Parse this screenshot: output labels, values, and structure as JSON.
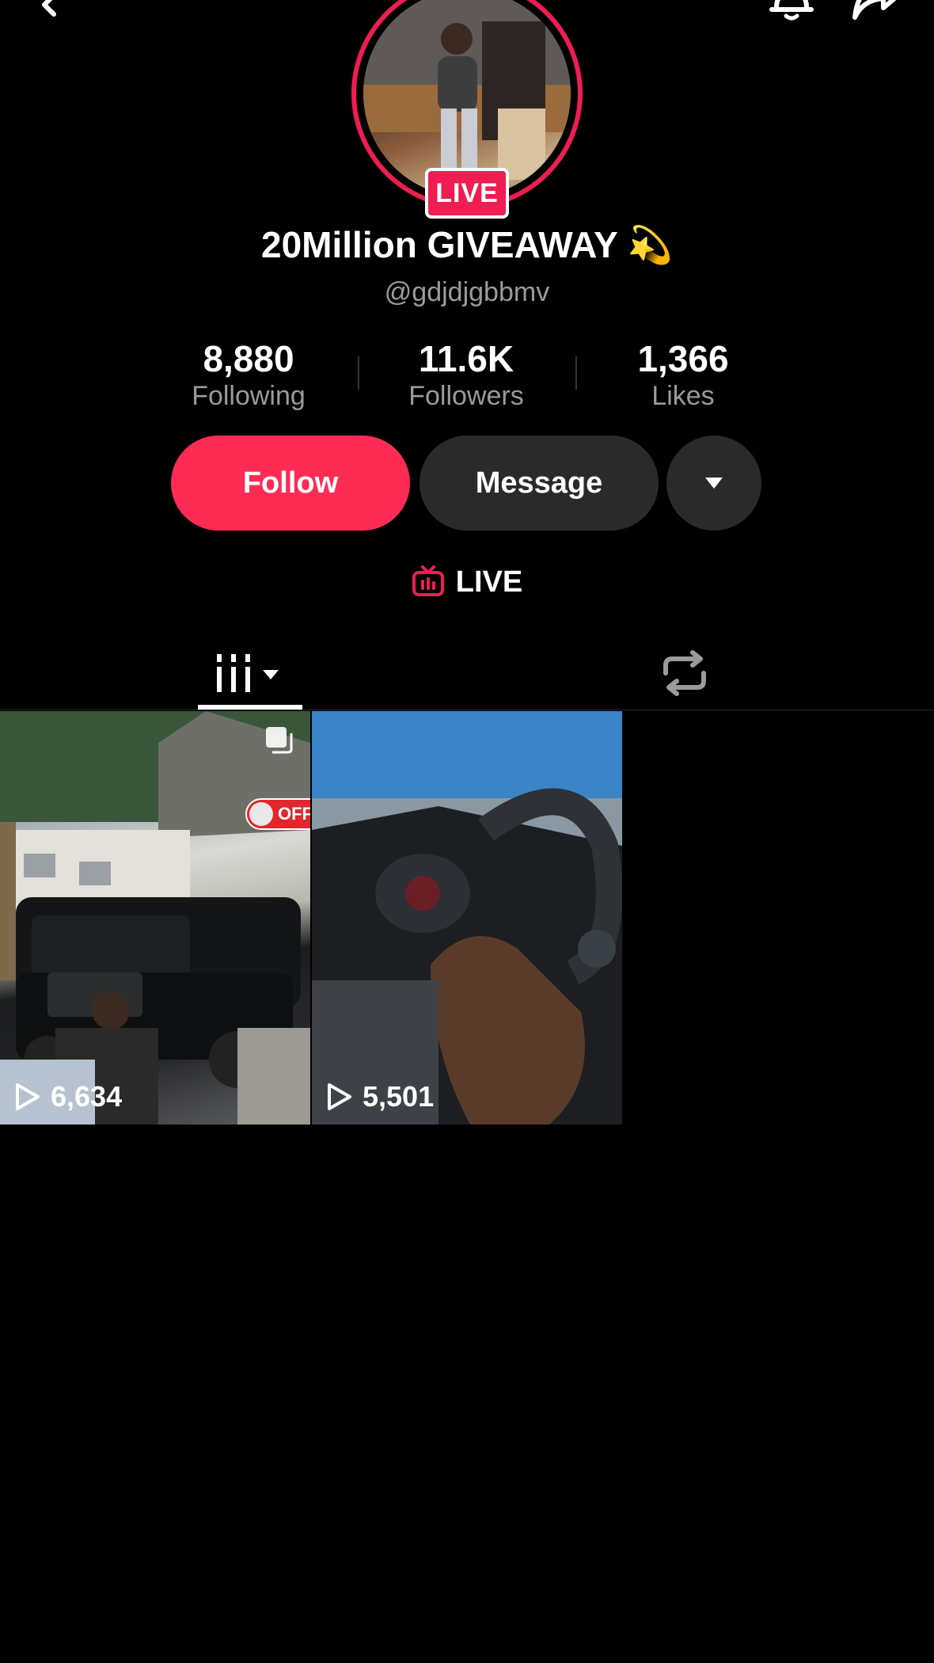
{
  "header": {
    "back_icon": "back-chevron-icon",
    "bell_icon": "bell-icon",
    "share_icon": "share-arrow-icon"
  },
  "profile": {
    "live_badge": "LIVE",
    "display_name": "20Million GIVEAWAY 💫",
    "handle": "@gdjdjgbbmv"
  },
  "stats": {
    "following": {
      "value": "8,880",
      "label": "Following"
    },
    "followers": {
      "value": "11.6K",
      "label": "Followers"
    },
    "likes": {
      "value": "1,366",
      "label": "Likes"
    }
  },
  "actions": {
    "follow_label": "Follow",
    "message_label": "Message",
    "more_icon": "caret-down-icon"
  },
  "live_link": {
    "label": "LIVE",
    "icon": "tv-live-icon",
    "color": "#ee1d52"
  },
  "tabs": {
    "videos_icon": "grid-columns-icon",
    "reposts_icon": "repost-icon"
  },
  "videos": [
    {
      "play_count": "6,634",
      "badge": "OFF",
      "multi_icon": "photo-stack-icon"
    },
    {
      "play_count": "5,501"
    }
  ],
  "colors": {
    "accent": "#fe2c55",
    "button_secondary": "#2a2a2a",
    "background": "#000000"
  }
}
